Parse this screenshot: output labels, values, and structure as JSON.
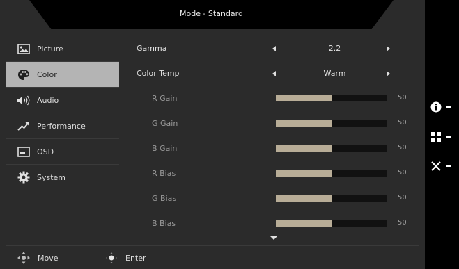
{
  "header": {
    "title": "Mode - Standard"
  },
  "menu": {
    "items": [
      {
        "label": "Picture"
      },
      {
        "label": "Color"
      },
      {
        "label": "Audio"
      },
      {
        "label": "Performance"
      },
      {
        "label": "OSD"
      },
      {
        "label": "System"
      }
    ],
    "active_index": 1
  },
  "settings": {
    "gamma": {
      "label": "Gamma",
      "value": "2.2"
    },
    "color_temp": {
      "label": "Color Temp",
      "value": "Warm"
    },
    "sliders": [
      {
        "label": "R Gain",
        "value": "50",
        "fraction": 0.5
      },
      {
        "label": "G Gain",
        "value": "50",
        "fraction": 0.5
      },
      {
        "label": "B Gain",
        "value": "50",
        "fraction": 0.5
      },
      {
        "label": "R Bias",
        "value": "50",
        "fraction": 0.5
      },
      {
        "label": "G Bias",
        "value": "50",
        "fraction": 0.5
      },
      {
        "label": "B Bias",
        "value": "50",
        "fraction": 0.5
      }
    ]
  },
  "footer": {
    "move_label": "Move",
    "enter_label": "Enter"
  },
  "side_keys": [
    {
      "icon": "info-icon"
    },
    {
      "icon": "grid-icon"
    },
    {
      "icon": "close-icon"
    }
  ],
  "colors": {
    "active_bg": "#b4b4b4",
    "bar_fill": "#b8ad97",
    "panel_bg": "#2b2b2b"
  }
}
